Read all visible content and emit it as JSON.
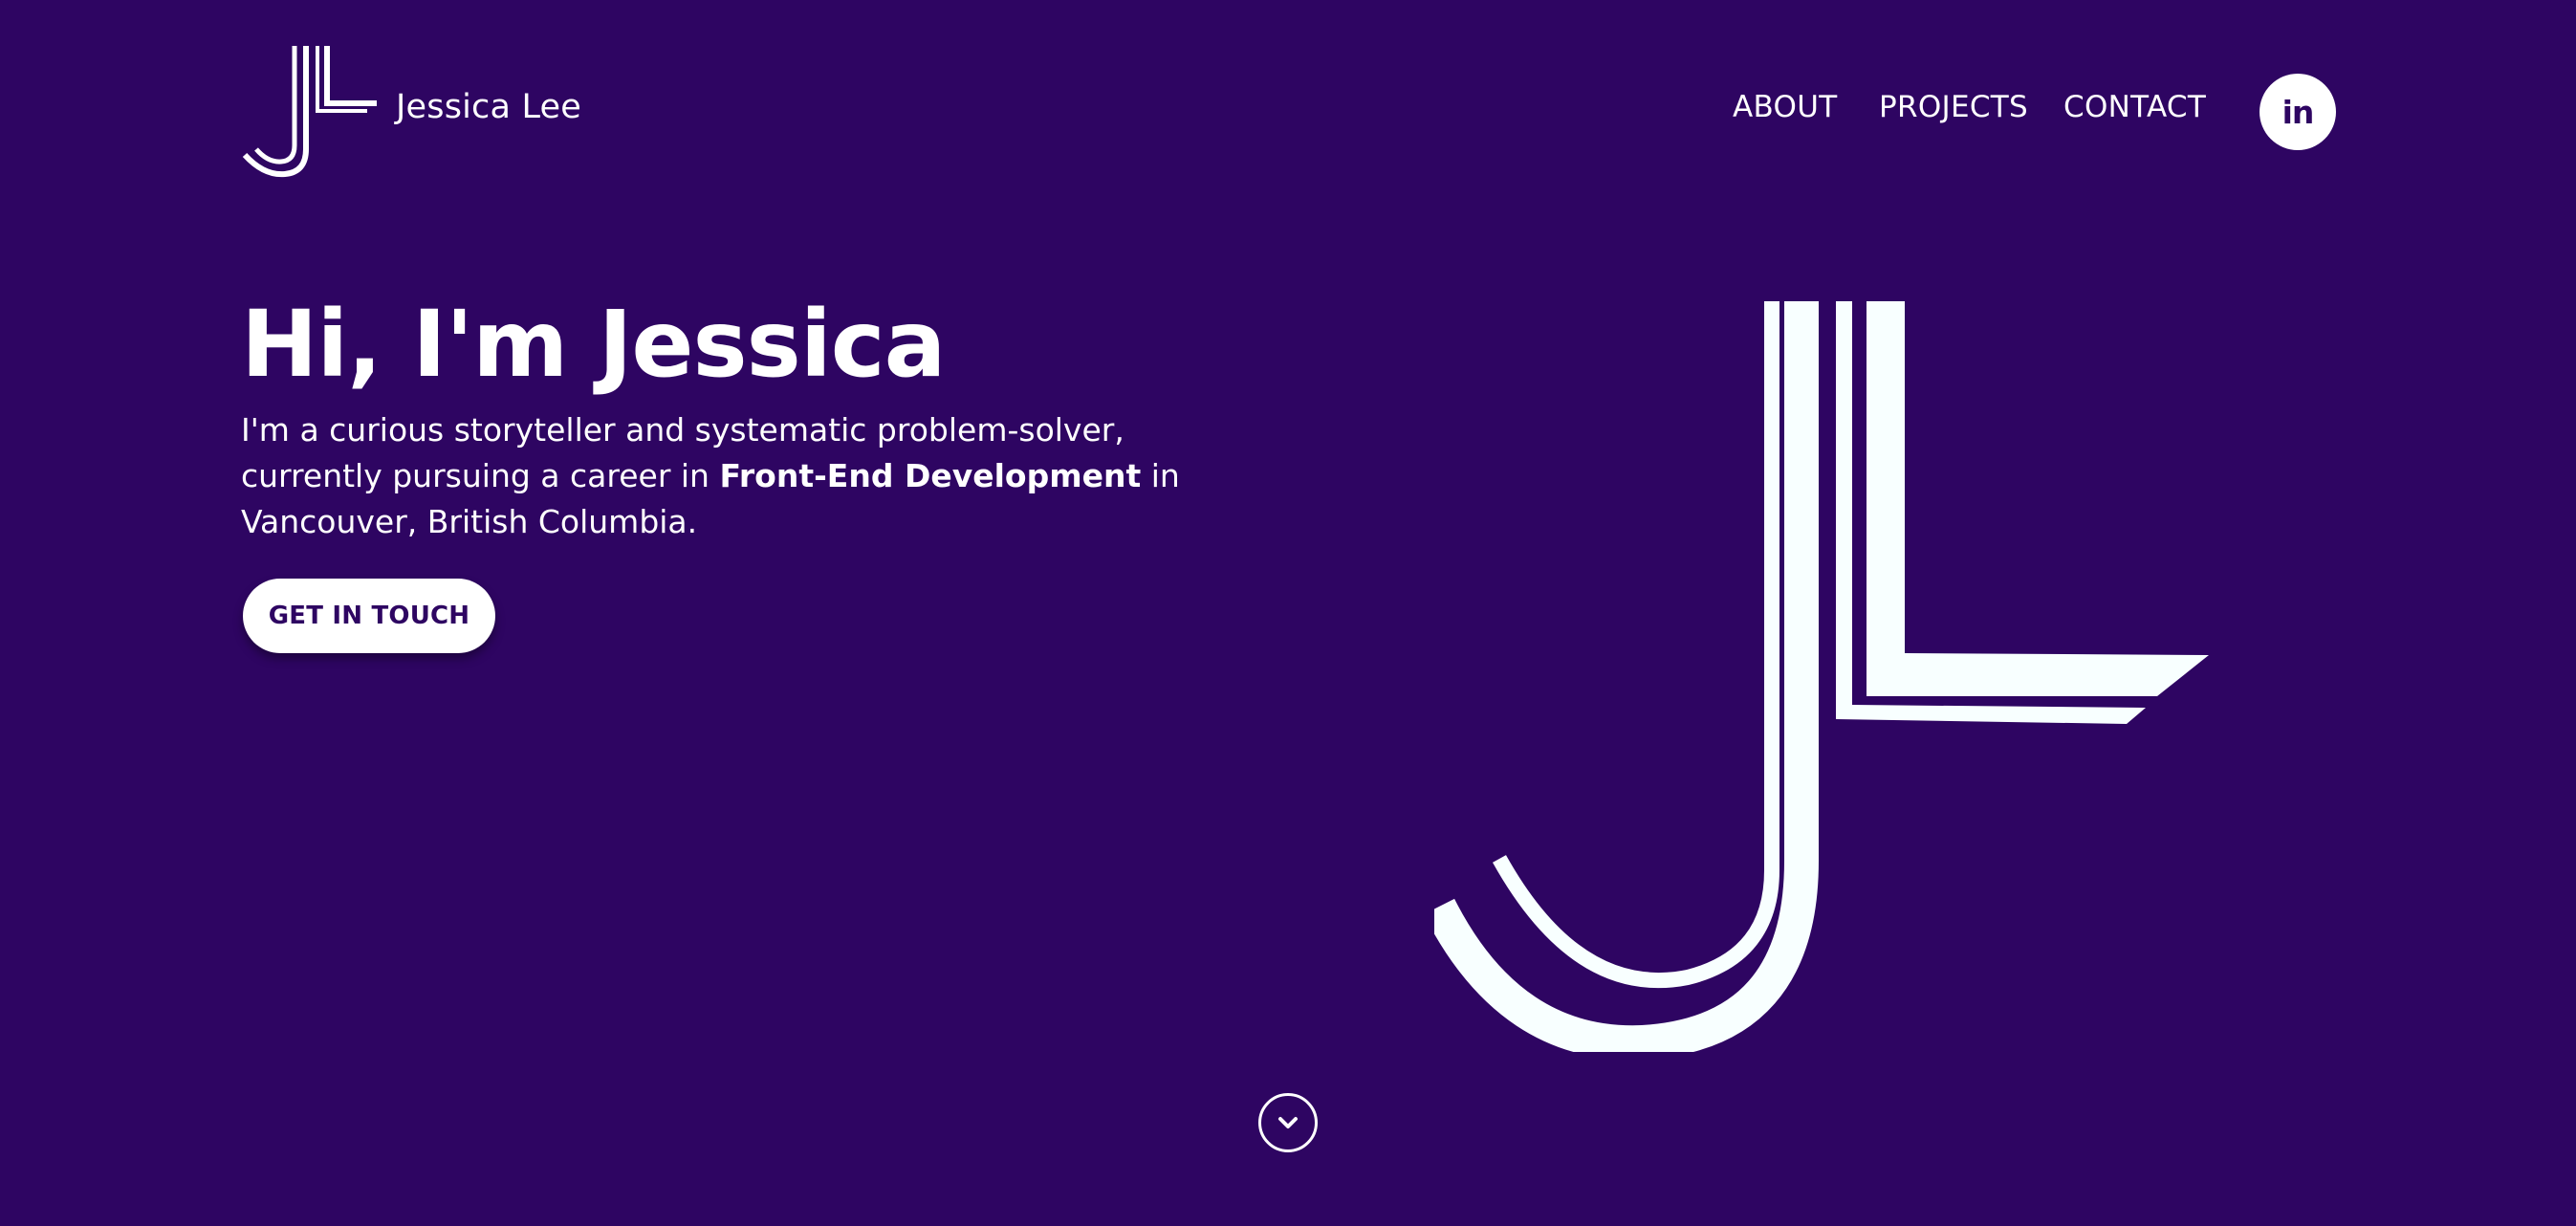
{
  "header": {
    "brand_name": "Jessica Lee",
    "logo_icon": "jl-monogram-icon",
    "nav": [
      {
        "label": "ABOUT"
      },
      {
        "label": "PROJECTS"
      },
      {
        "label": "CONTACT"
      }
    ],
    "social": {
      "icon": "linkedin-icon",
      "glyph": "in"
    }
  },
  "hero": {
    "title": "Hi, I'm Jessica",
    "intro_before": "I'm a curious storyteller and systematic problem-solver, currently pursuing a career in ",
    "intro_bold": "Front-End Development",
    "intro_after": " in Vancouver, British Columbia.",
    "cta_label": "GET IN TOUCH",
    "illustration_icon": "jl-monogram-icon",
    "scroll_icon": "chevron-down-icon"
  },
  "colors": {
    "background": "#2e0562",
    "foreground": "#ffffff",
    "accent_text": "#2e0562"
  }
}
